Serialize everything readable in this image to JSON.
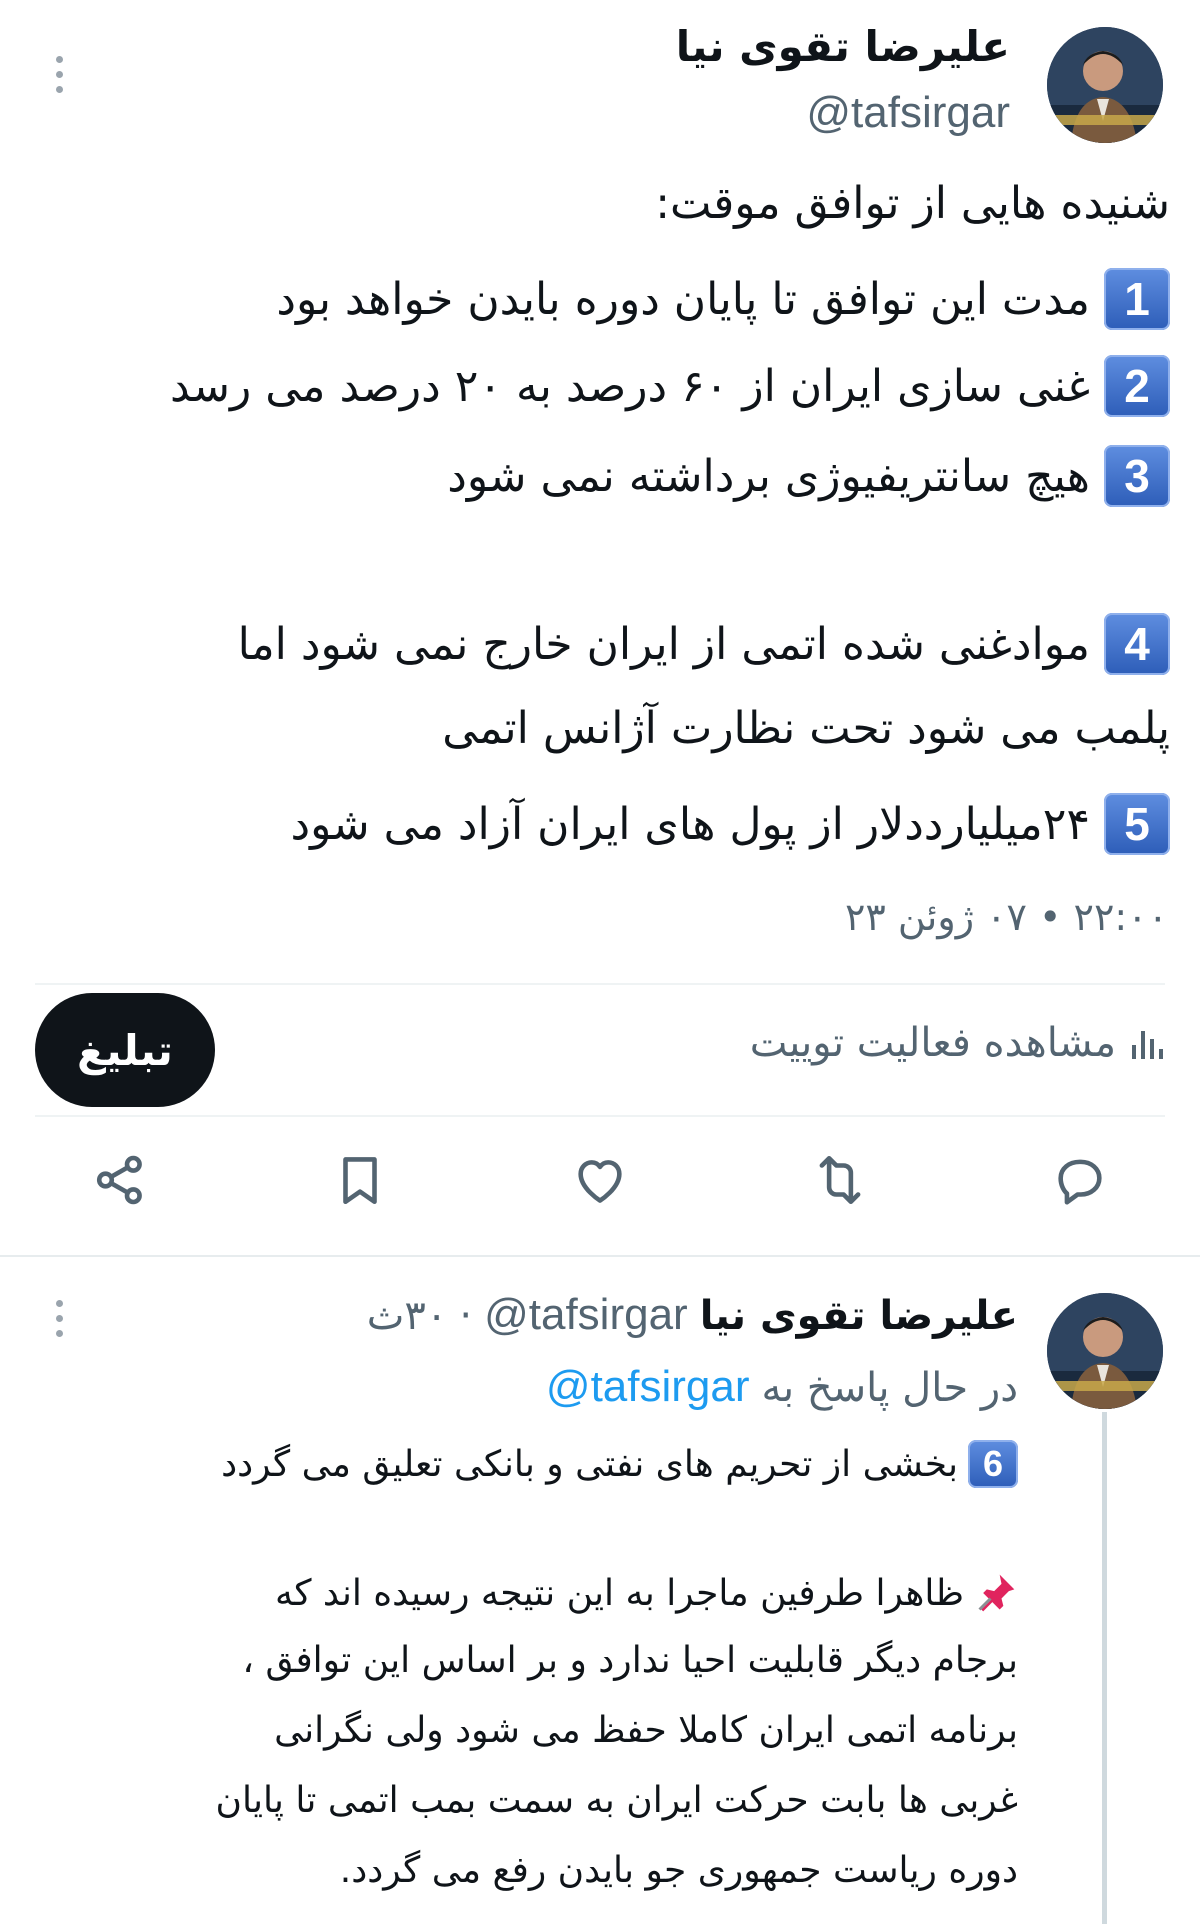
{
  "tweet": {
    "author_name": "علیرضا تقوی نیا",
    "author_handle": "@tafsirgar",
    "lines": [
      {
        "badge": "",
        "text": "شنیده هایی از توافق موقت:"
      },
      {
        "badge": "1",
        "text": "مدت این توافق تا پایان دوره بایدن خواهد بود"
      },
      {
        "badge": "2",
        "text": "غنی سازی ایران از ۶۰ درصد به ۲۰ درصد می رسد"
      },
      {
        "badge": "3",
        "text": "هیچ سانتریفیوژی برداشته نمی شود"
      },
      {
        "badge": "4",
        "text": "موادغنی شده اتمی از ایران خارج نمی شود اما"
      },
      {
        "badge": "",
        "text": "پلمب می شود تحت نظارت آژانس اتمی"
      },
      {
        "badge": "5",
        "text": "۲۴میلیارددلار از پول های ایران آزاد می شود"
      }
    ],
    "timestamp": "۲۲:۰۰ • ۰۷ ژوئن ۲۳",
    "activity_label": "مشاهده فعالیت توییت",
    "promote_label": "تبلیغ"
  },
  "actions": {
    "icons": [
      "reply-icon",
      "retweet-icon",
      "like-icon",
      "bookmark-icon",
      "share-icon"
    ]
  },
  "reply": {
    "author_name": "علیرضا تقوی نیا",
    "author_handle": "@tafsirgar",
    "separator": "·",
    "time": "۳۰ث",
    "replying_to_label": "در حال پاسخ به",
    "replying_to_handle": "@tafsirgar",
    "lines": [
      {
        "badge": "6",
        "pin": false,
        "text": "بخشی از تحریم های نفتی و بانکی تعلیق می گردد"
      },
      {
        "badge": "",
        "pin": true,
        "text": "ظاهرا طرفین ماجرا به این نتیجه رسیده اند که"
      },
      {
        "badge": "",
        "pin": false,
        "text": "برجام دیگر قابلیت احیا ندارد و بر اساس این توافق ،"
      },
      {
        "badge": "",
        "pin": false,
        "text": "برنامه اتمی ایران کاملا حفظ می شود ولی نگرانی"
      },
      {
        "badge": "",
        "pin": false,
        "text": "غربی ها بابت حرکت ایران به سمت بمب اتمی تا پایان"
      },
      {
        "badge": "",
        "pin": false,
        "text": "دوره ریاست جمهوری جو بایدن رفع می گردد."
      }
    ]
  },
  "colors": {
    "accent": "#1d9bf0",
    "text": "#0f1419",
    "secondary": "#536471",
    "badge": "#3b6cc8"
  }
}
